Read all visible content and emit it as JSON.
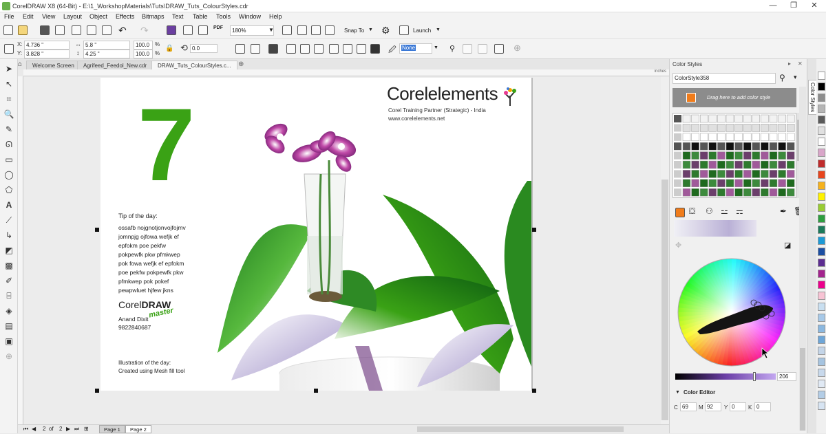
{
  "window": {
    "title": "CorelDRAW X8 (64-Bit) - E:\\1_WorkshopMaterials\\Tuts\\DRAW_Tuts_ColourStyles.cdr",
    "controls": [
      "—",
      "❐",
      "✕"
    ]
  },
  "menu": [
    "File",
    "Edit",
    "View",
    "Layout",
    "Object",
    "Effects",
    "Bitmaps",
    "Text",
    "Table",
    "Tools",
    "Window",
    "Help"
  ],
  "toolbar": {
    "zoom": "180%",
    "snap_to": "Snap To",
    "launch": "Launch",
    "pdf": "PDF"
  },
  "property_bar": {
    "x": "4.736 \"",
    "y": "3.828 \"",
    "width": "5.8 \"",
    "height": "4.25 \"",
    "scale_x": "100.0",
    "scale_y": "100.0",
    "percent": "%",
    "rotation": "0.0",
    "outline": "None",
    "x_label": "X:",
    "y_label": "Y:"
  },
  "doc_tabs": [
    "Welcome Screen",
    "Agrifeed_Feedol_New.cdr",
    "DRAW_Tuts_ColourStyles.c..."
  ],
  "ruler_unit": "inches",
  "page": {
    "big_number": "7",
    "logo_dark": "Corel",
    "logo_green": "elements",
    "partner_line": "Corel Training Partner (Strategic) - India",
    "website": "www.corelelements.net",
    "tip_title": "Tip of the day:",
    "tip_lines": [
      "ossafb nojgnotjonvojfojmv",
      "jomnpjg ojfowa wefjk ef",
      "epfokm poe pekfw",
      "pokpewfk pkw pfmkwep",
      "pok fowa wefjk ef epfokm",
      "poe pekfw pokpewfk pkw",
      "pfmkwep pok pokef",
      "pewpwluet hjfew jkns"
    ],
    "brand_corel": "Corel",
    "brand_draw": "DRAW",
    "brand_master": "master",
    "author": "Anand Dixit",
    "phone": "9822840687",
    "illus_title": "Illustration of the day:",
    "illus_desc": "Created using Mesh fill tool"
  },
  "status": {
    "page_of": "2",
    "of": "of",
    "page_total": "2",
    "tabs": [
      "Page 1",
      "Page 2"
    ]
  },
  "panel": {
    "title": "Color Styles",
    "style_name": "ColorStyle358",
    "drop_hint": "Drag here to add color style",
    "slider_value": "206",
    "editor_title": "Color Editor",
    "cmyk": {
      "c_label": "C",
      "c": "69",
      "m_label": "M",
      "m": "92",
      "y_label": "Y",
      "y": "0",
      "k_label": "K",
      "k": "0"
    },
    "side_tab": "Color Styles"
  },
  "colors": {
    "accent_green": "#3aa215",
    "orange_swatch": "#f07c1b",
    "selection_blue": "#3a78d6"
  },
  "palette_colors": [
    "#ffffff",
    "#000000",
    "#8d8d8d",
    "#b5b5b5",
    "#5a5a5a",
    "#e0e0e0",
    "#ffffff",
    "#d9a6c9",
    "#c02c2c",
    "#e8451d",
    "#f6b21d",
    "#fff200",
    "#99cc33",
    "#2e9e3f",
    "#1c7a5a",
    "#1d9ad6",
    "#1c4fa3",
    "#5c2d91",
    "#a3238e",
    "#ec008c",
    "#f7c3d4",
    "#c9dff0",
    "#a7c9e8",
    "#8bb8e0",
    "#6ea6d8",
    "#c4d5e8",
    "#a6c4e0",
    "#c8d9ec",
    "#e0e9f4",
    "#b3cde6",
    "#d7e4f2"
  ]
}
